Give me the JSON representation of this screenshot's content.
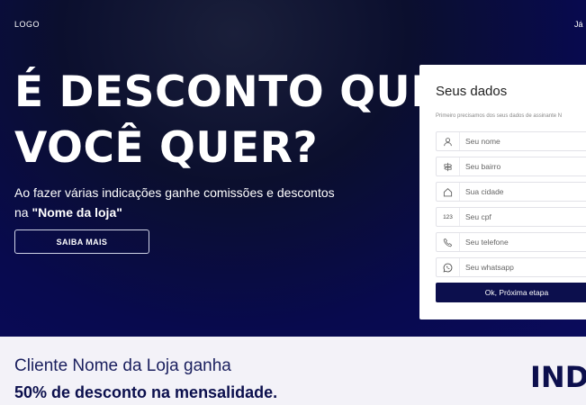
{
  "header": {
    "logo": "LOGO",
    "login_link": "Já"
  },
  "hero": {
    "headline_line1": "É DESCONTO QUE",
    "headline_line2": "VOCÊ QUER?",
    "subtitle_text": "Ao fazer várias indicações ganhe comissões e descontos",
    "subtitle_prefix": "na ",
    "store_name": "\"Nome da loja\"",
    "cta_label": "SAIBA MAIS"
  },
  "form": {
    "title": "Seus dados",
    "description": "Primeiro precisamos dos seus dados de assinante N",
    "fields": [
      {
        "placeholder": "Seu nome",
        "icon": "user-icon"
      },
      {
        "placeholder": "Seu bairro",
        "icon": "signpost-icon"
      },
      {
        "placeholder": "Sua cidade",
        "icon": "home-icon"
      },
      {
        "placeholder": "Seu cpf",
        "icon": "numbers-icon",
        "icon_text": "123"
      },
      {
        "placeholder": "Seu telefone",
        "icon": "phone-icon"
      },
      {
        "placeholder": "Seu whatsapp",
        "icon": "whatsapp-icon"
      }
    ],
    "submit_label": "Ok, Próxima etapa"
  },
  "benefit": {
    "line1": "Cliente Nome da Loja ganha",
    "line2": "50% de desconto na mensalidade.",
    "side_text": "INDI"
  },
  "colors": {
    "navy": "#0c0f4d",
    "hero_bg": "#0b0f2e",
    "bottom_bg": "#f3f2f8"
  }
}
